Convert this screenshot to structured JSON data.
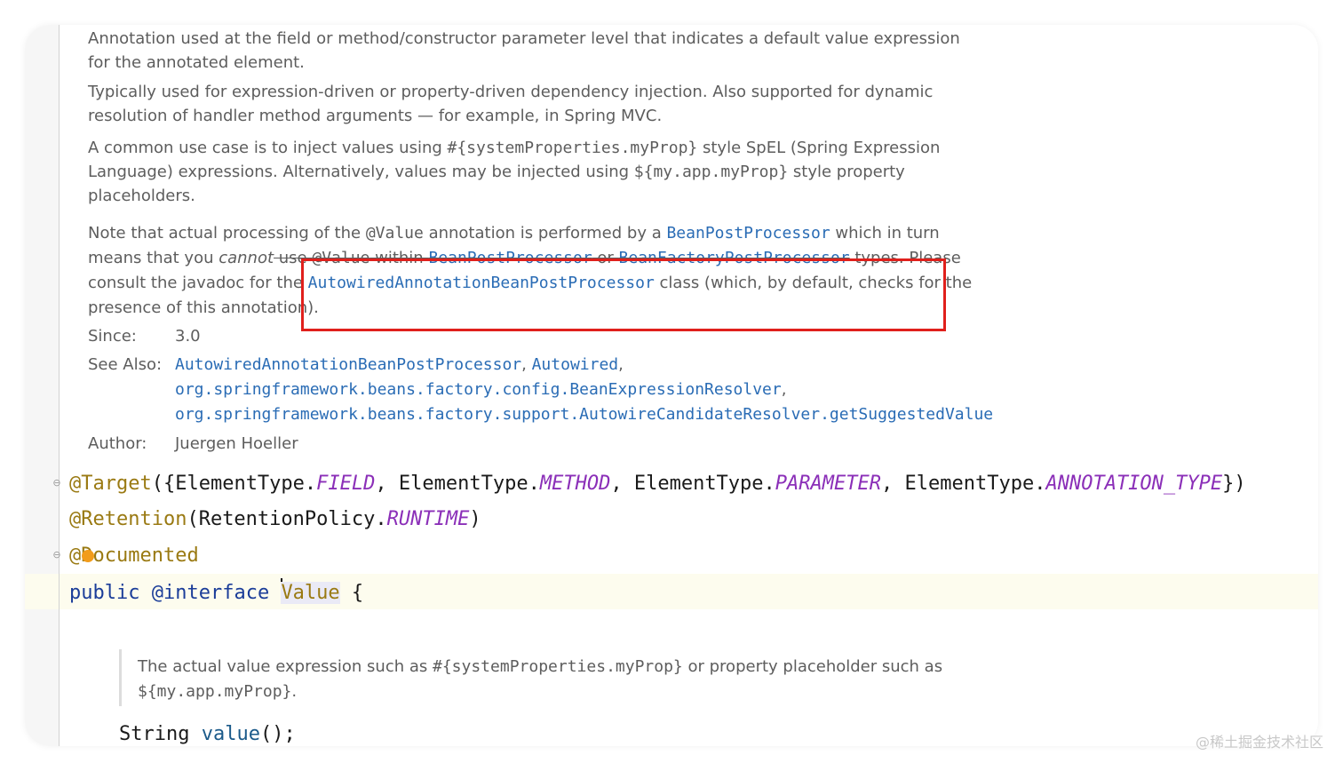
{
  "doc": {
    "para1": "Annotation used at the field or method/constructor parameter level that indicates a default value expression for the annotated element.",
    "para2": "Typically used for expression-driven or property-driven dependency injection. Also supported for dynamic resolution of handler method arguments — for example, in Spring MVC.",
    "para3": {
      "t1": "A common use case is to inject values using ",
      "c1": "#{systemProperties.myProp}",
      "t2": " style SpEL (Spring Expression Language) expressions. Alternatively, values may be injected using ",
      "c2": "${my.app.myProp}",
      "t3": " style property placeholders."
    },
    "para4": {
      "t1": "Note that actual processing of the ",
      "c1": "@Value",
      "t2": " annotation is performed by a ",
      "l1": "BeanPostProcessor",
      "t3": " which in turn means that you ",
      "em": "cannot",
      "t4": " use ",
      "c2": "@Value",
      "t5": " within ",
      "l2": "BeanPostProcessor",
      "t6": " or ",
      "l3": "BeanFactoryPostProcessor",
      "t7": " types. Please consult the javadoc for the ",
      "l4": "AutowiredAnnotationBeanPostProcessor",
      "t8": " class (which, by default, checks for the presence of this annotation)."
    },
    "since_label": "Since:",
    "since_value": "3.0",
    "see_also_label": "See Also:",
    "see_also": {
      "l1": "AutowiredAnnotationBeanPostProcessor",
      "sep1": ", ",
      "l2": "Autowired",
      "sep2": ", ",
      "l3": "org.springframework.beans.factory.config.BeanExpressionResolver",
      "sep3": ", ",
      "l4": "org.springframework.beans.factory.support.AutowireCandidateResolver.getSuggestedValue"
    },
    "author_label": "Author:",
    "author_value": "Juergen Hoeller"
  },
  "code": {
    "target": {
      "ann": "@Target",
      "open": "({",
      "et1": "ElementType.",
      "f1": "FIELD",
      "s1": ", ",
      "et2": "ElementType.",
      "f2": "METHOD",
      "s2": ", ",
      "et3": "ElementType.",
      "f3": "PARAMETER",
      "s3": ", ",
      "et4": "ElementType.",
      "f4": "ANNOTATION_TYPE",
      "close": "})"
    },
    "retention": {
      "ann": "@Retention",
      "open": "(RetentionPolicy.",
      "f": "RUNTIME",
      "close": ")"
    },
    "documented": "@Documented",
    "decl": {
      "public": "public",
      "interface": "@interface",
      "name": "Value",
      "brace": "{"
    },
    "inner_doc": {
      "t1": "The actual value expression such as ",
      "c1": "#{systemProperties.myProp}",
      "t2": " or property placeholder such as ",
      "c2": "${my.app.myProp}",
      "t3": "."
    },
    "method": {
      "type": "String",
      "name": "value",
      "end": "();"
    }
  },
  "watermark": "@稀土掘金技术社区"
}
